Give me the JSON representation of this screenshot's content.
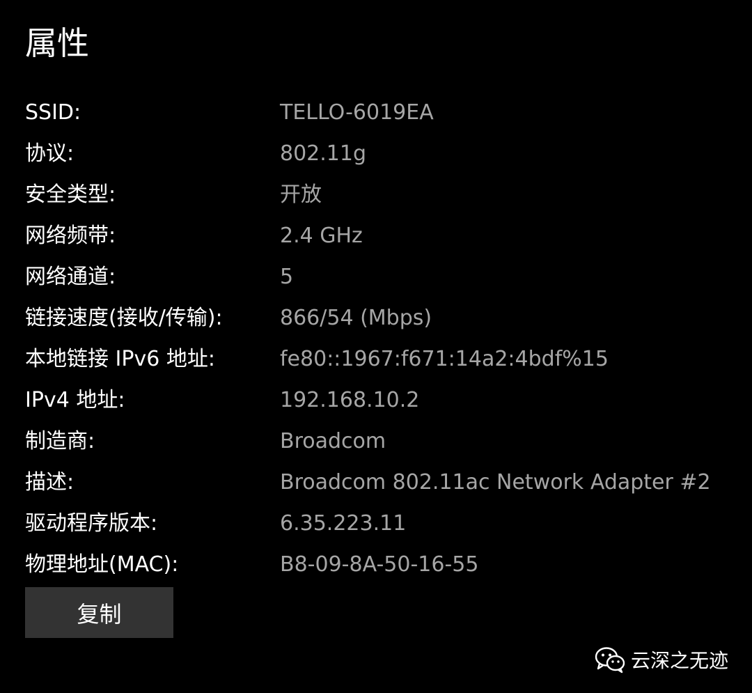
{
  "title": "属性",
  "properties": [
    {
      "label": "SSID:",
      "value": "TELLO-6019EA"
    },
    {
      "label": "协议:",
      "value": "802.11g"
    },
    {
      "label": "安全类型:",
      "value": "开放"
    },
    {
      "label": "网络频带:",
      "value": "2.4 GHz"
    },
    {
      "label": "网络通道:",
      "value": "5"
    },
    {
      "label": "链接速度(接收/传输):",
      "value": "866/54 (Mbps)"
    },
    {
      "label": "本地链接 IPv6 地址:",
      "value": "fe80::1967:f671:14a2:4bdf%15"
    },
    {
      "label": "IPv4 地址:",
      "value": "192.168.10.2"
    },
    {
      "label": "制造商:",
      "value": "Broadcom"
    },
    {
      "label": "描述:",
      "value": "Broadcom 802.11ac Network Adapter #2"
    },
    {
      "label": "驱动程序版本:",
      "value": "6.35.223.11"
    },
    {
      "label": "物理地址(MAC):",
      "value": "B8-09-8A-50-16-55"
    }
  ],
  "copy_button_label": "复制",
  "watermark": {
    "icon": "wechat-icon",
    "text": "云深之无迹"
  },
  "colors": {
    "background": "#000000",
    "label": "#ffffff",
    "value": "#a6a6a6",
    "button": "#333333"
  }
}
